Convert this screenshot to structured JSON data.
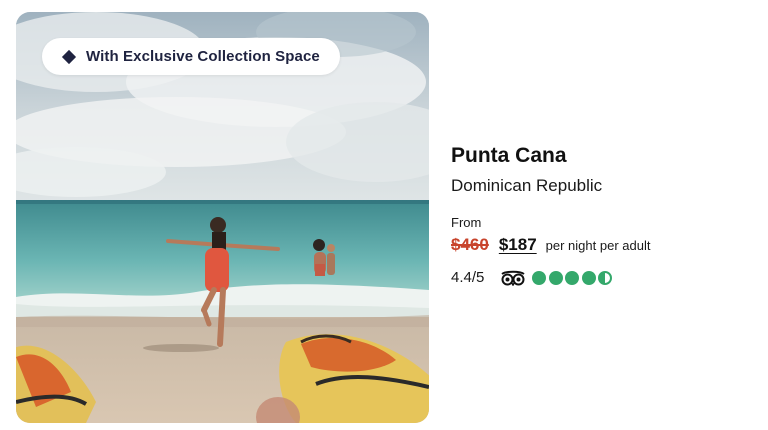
{
  "card": {
    "badge_label": "With Exclusive Collection Space",
    "title": "Punta Cana",
    "subtitle": "Dominican Republic",
    "from_label": "From",
    "old_price": "$460",
    "new_price": "$187",
    "price_unit": "per night per adult",
    "rating_text": "4.4/5",
    "rating_value": 4.4,
    "rating_max": 5,
    "review_icon": "tripadvisor-owl-icon",
    "colors": {
      "strike_price": "#c8442c",
      "bubble_green": "#34a86b",
      "badge_text": "#1f2340"
    }
  }
}
